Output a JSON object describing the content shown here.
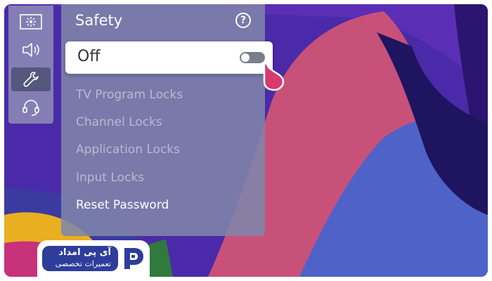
{
  "panel": {
    "title": "Safety",
    "help_icon": "question-mark-icon",
    "help_glyph": "?",
    "safety_toggle": {
      "label": "Off",
      "state": "off"
    },
    "items": [
      {
        "label": "TV Program Locks",
        "enabled": false
      },
      {
        "label": "Channel Locks",
        "enabled": false
      },
      {
        "label": "Application Locks",
        "enabled": false
      },
      {
        "label": "Input Locks",
        "enabled": false
      },
      {
        "label": "Reset Password",
        "enabled": true
      }
    ]
  },
  "rail": {
    "items": [
      {
        "icon": "picture-icon",
        "active": false
      },
      {
        "icon": "sound-icon",
        "active": false
      },
      {
        "icon": "wrench-icon",
        "active": true
      },
      {
        "icon": "headset-support-icon",
        "active": false
      }
    ]
  },
  "logo": {
    "line1": "آی پی امداد",
    "line2": "تعمیرات تخصصی"
  },
  "colors": {
    "accent_pointer": "#d63a6e",
    "logo_blue": "#2e3d9b",
    "panel_bg": "#8084aa",
    "wallpaper_purple": "#4a2aa8",
    "wallpaper_pink": "#c8517a"
  }
}
